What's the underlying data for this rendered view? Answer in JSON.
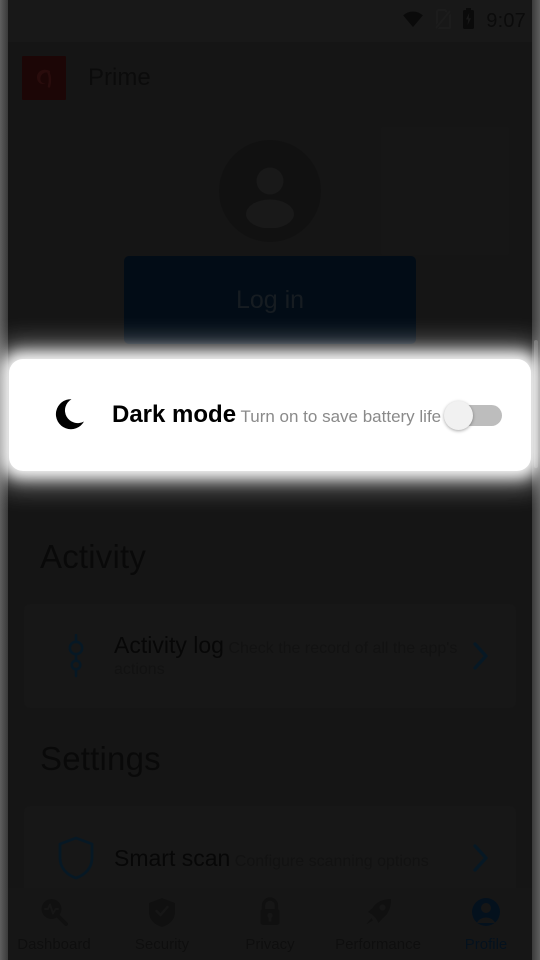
{
  "statusbar": {
    "time": "9:07",
    "icons": [
      "wifi-icon",
      "no-sim-icon",
      "battery-charging-icon"
    ]
  },
  "appbar": {
    "logo_icon": "avira-umbrella-logo",
    "title": "Prime",
    "logo_color": "#4a1111"
  },
  "profile": {
    "avatar_icon": "person-avatar-icon",
    "login_label": "Log in",
    "login_bg": "#07203a"
  },
  "spotlight": {
    "icon": "crescent-moon-icon",
    "title": "Dark mode",
    "subtitle": "Turn on to save battery life",
    "toggle_state": "off",
    "toggle_track_color": "#bdbdbd",
    "toggle_thumb_color": "#f1f1f1",
    "card_bg": "#ffffff"
  },
  "sections": [
    {
      "heading": "Activity",
      "items": [
        {
          "icon": "activity-timeline-icon",
          "title": "Activity log",
          "subtitle": "Check the record of all the app's actions",
          "chevron": "chevron-right-icon"
        }
      ]
    },
    {
      "heading": "Settings",
      "items": [
        {
          "icon": "shield-icon",
          "title": "Smart scan",
          "subtitle": "Configure scanning options",
          "chevron": "chevron-right-icon"
        }
      ]
    }
  ],
  "bottomnav": {
    "active_color": "#0d2d4d",
    "tabs": [
      {
        "icon": "dashboard-magnifier-icon",
        "label": "Dashboard",
        "active": false
      },
      {
        "icon": "security-shield-check-icon",
        "label": "Security",
        "active": false
      },
      {
        "icon": "privacy-lock-icon",
        "label": "Privacy",
        "active": false
      },
      {
        "icon": "performance-rocket-icon",
        "label": "Performance",
        "active": false
      },
      {
        "icon": "profile-avatar-icon",
        "label": "Profile",
        "active": true
      }
    ]
  }
}
